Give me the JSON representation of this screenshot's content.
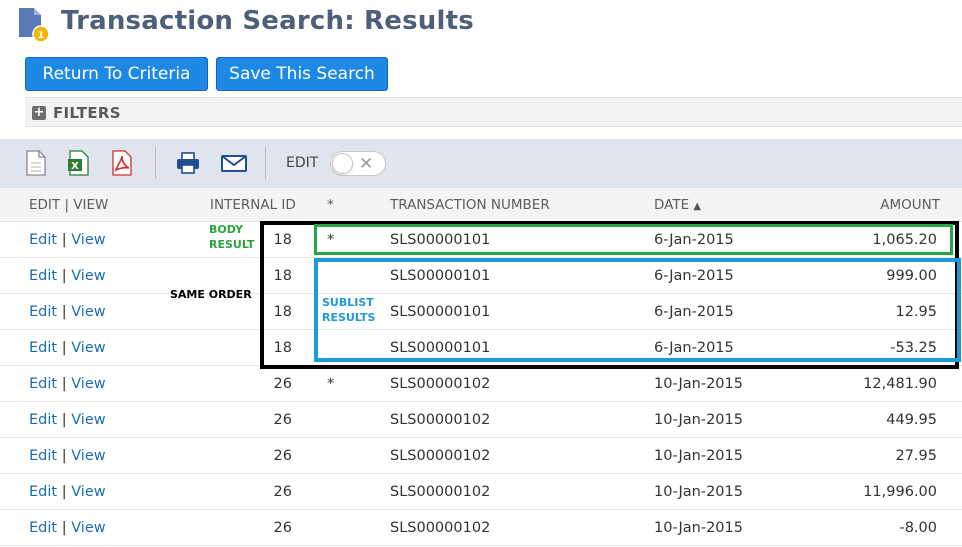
{
  "page": {
    "title": "Transaction Search: Results"
  },
  "buttons": {
    "return_label": "Return To Criteria",
    "save_label": "Save This Search"
  },
  "filters": {
    "label": "FILTERS"
  },
  "toolbar": {
    "icons": [
      "new-document-icon",
      "export-excel-icon",
      "export-pdf-icon",
      "print-icon",
      "email-icon"
    ],
    "edit_label": "EDIT",
    "edit_toggle_on": false
  },
  "table": {
    "headers": {
      "edit_view": "EDIT | VIEW",
      "internal_id": "INTERNAL ID",
      "star": "*",
      "transaction_number": "TRANSACTION NUMBER",
      "date": "DATE",
      "amount": "AMOUNT"
    },
    "sort_indicator": "▲",
    "edit_link": "Edit",
    "link_separator": "|",
    "view_link": "View",
    "rows": [
      {
        "id": "18",
        "star": "*",
        "txn": "SLS00000101",
        "date": "6-Jan-2015",
        "amount": "1,065.20"
      },
      {
        "id": "18",
        "star": "",
        "txn": "SLS00000101",
        "date": "6-Jan-2015",
        "amount": "999.00"
      },
      {
        "id": "18",
        "star": "",
        "txn": "SLS00000101",
        "date": "6-Jan-2015",
        "amount": "12.95"
      },
      {
        "id": "18",
        "star": "",
        "txn": "SLS00000101",
        "date": "6-Jan-2015",
        "amount": "-53.25"
      },
      {
        "id": "26",
        "star": "*",
        "txn": "SLS00000102",
        "date": "10-Jan-2015",
        "amount": "12,481.90"
      },
      {
        "id": "26",
        "star": "",
        "txn": "SLS00000102",
        "date": "10-Jan-2015",
        "amount": "449.95"
      },
      {
        "id": "26",
        "star": "",
        "txn": "SLS00000102",
        "date": "10-Jan-2015",
        "amount": "27.95"
      },
      {
        "id": "26",
        "star": "",
        "txn": "SLS00000102",
        "date": "10-Jan-2015",
        "amount": "11,996.00"
      },
      {
        "id": "26",
        "star": "",
        "txn": "SLS00000102",
        "date": "10-Jan-2015",
        "amount": "-8.00"
      }
    ]
  },
  "annotations": {
    "body_result_line1": "BODY",
    "body_result_line2": "RESULT",
    "same_order": "SAME ORDER",
    "sublist_line1": "SUBLIST",
    "sublist_line2": "RESULTS",
    "colors": {
      "body_box": "#28a745",
      "sublist_box": "#1e9ad6",
      "order_box": "#000000"
    }
  },
  "colors": {
    "title": "#4d5f79",
    "button": "#1e88e5",
    "link": "#1a6db5",
    "toolbar_bg": "#dfe4ee"
  }
}
